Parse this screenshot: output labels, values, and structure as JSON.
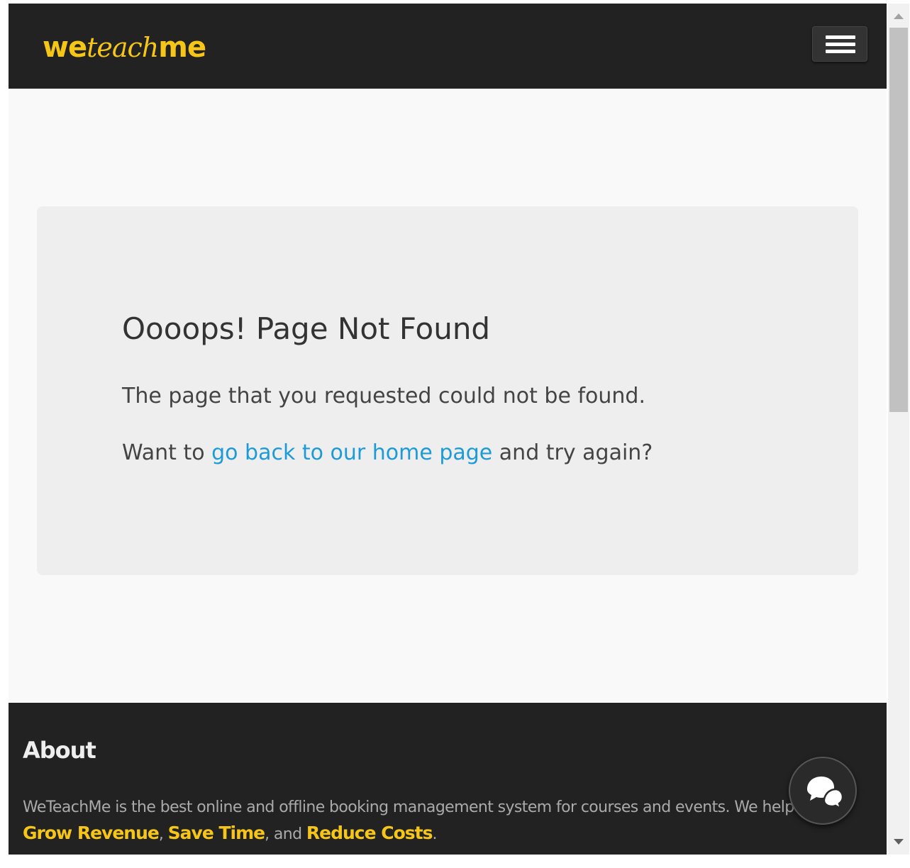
{
  "header": {
    "logo_part1": "we",
    "logo_part2": "teach",
    "logo_part3": "me",
    "menu_icon": "hamburger-icon"
  },
  "error": {
    "title": "Oooops! Page Not Found",
    "message": "The page that you requested could not be found.",
    "prompt_prefix": "Want to ",
    "home_link": "go back to our home page",
    "prompt_suffix": " and try again?"
  },
  "footer": {
    "about_heading": "About",
    "about_text": "WeTeachMe is the best online and offline booking management system for courses and events. We help you",
    "highlight_1": "Grow Revenue",
    "sep_1": ", ",
    "highlight_2": "Save Time",
    "sep_2": ", and ",
    "highlight_3": "Reduce Costs",
    "end": "."
  },
  "chat": {
    "icon": "chat-bubbles-icon"
  },
  "colors": {
    "brand_yellow": "#f5c518",
    "dark_bg": "#222222",
    "link_blue": "#1e9bd7",
    "card_bg": "#eeeeee",
    "page_bg": "#f9f9f9"
  }
}
